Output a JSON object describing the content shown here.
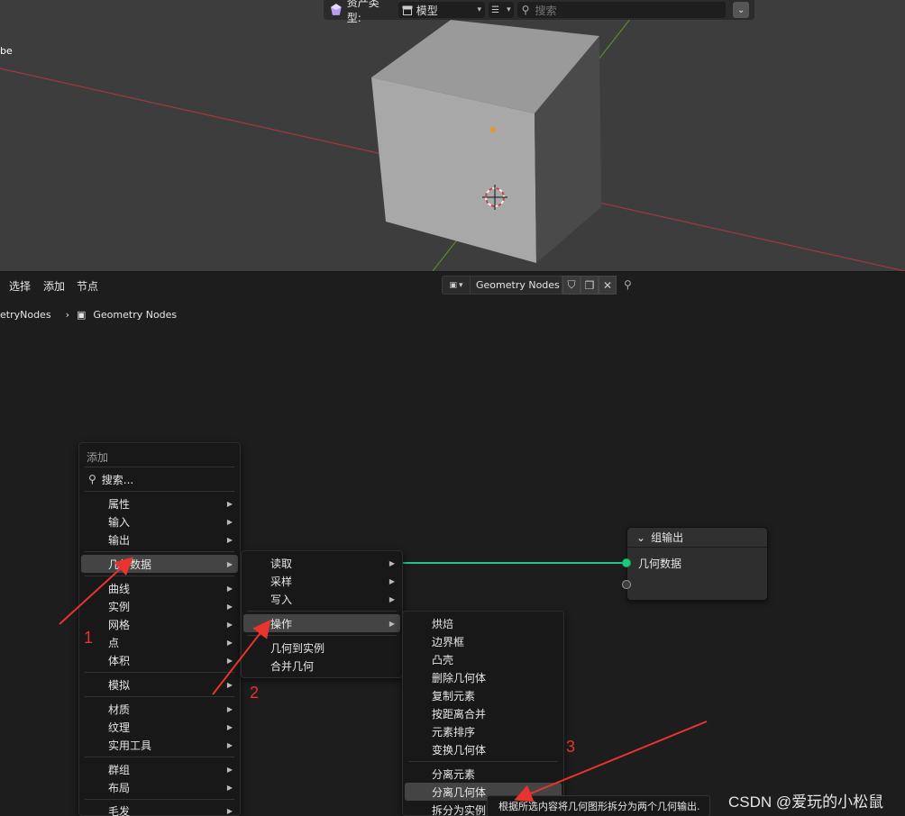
{
  "viewport": {
    "object_label": "be",
    "asset_bar": {
      "type_label": "资产类型:",
      "type_value": "模型",
      "search_placeholder": "搜索"
    }
  },
  "header": {
    "menus": [
      "选择",
      "添加",
      "节点"
    ],
    "node_tree_name": "Geometry Nodes"
  },
  "breadcrumb": {
    "parent": "etryNodes",
    "current": "Geometry Nodes"
  },
  "output_node": {
    "title": "组输出",
    "socket_label": "几何数据"
  },
  "add_menu": {
    "title": "添加",
    "search": "搜索...",
    "items": [
      "属性",
      "输入",
      "输出",
      "几何数据",
      "曲线",
      "实例",
      "网格",
      "点",
      "体积",
      "模拟",
      "材质",
      "纹理",
      "实用工具",
      "群组",
      "布局",
      "毛发"
    ]
  },
  "geometry_menu": {
    "items": [
      "读取",
      "采样",
      "写入",
      "操作",
      "几何到实例",
      "合并几何"
    ]
  },
  "operations_menu": {
    "items": [
      "烘焙",
      "边界框",
      "凸壳",
      "删除几何体",
      "复制元素",
      "按距离合并",
      "元素排序",
      "变换几何体",
      "分离元素",
      "分离几何体",
      "拆分为实例"
    ]
  },
  "tooltip": "根据所选内容将几何图形拆分为两个几何输出.",
  "annotations": [
    "1",
    "2",
    "3"
  ],
  "watermark": "CSDN @爱玩的小松鼠",
  "colors": {
    "geometry_link": "#1fc48e",
    "annotation": "#e8332e"
  }
}
